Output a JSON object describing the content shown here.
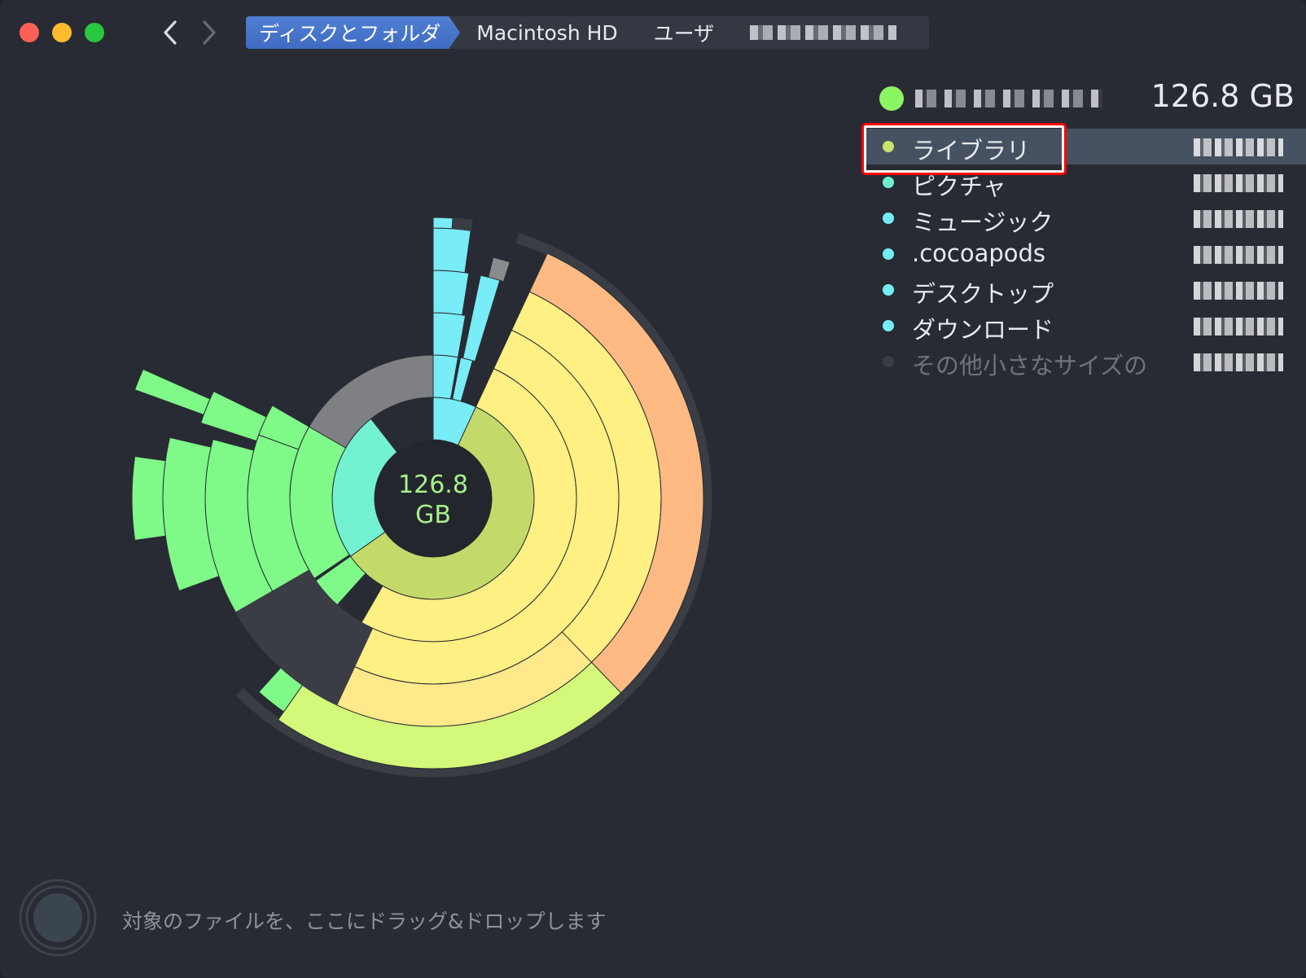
{
  "toolbar": {
    "breadcrumb": [
      {
        "label": "ディスクとフォルダ"
      },
      {
        "label": "Macintosh HD"
      },
      {
        "label": "ユーザ"
      }
    ]
  },
  "chart": {
    "center_label_line1": "126.8",
    "center_label_line2": "GB"
  },
  "panel": {
    "header_size": "126.8 GB",
    "items": [
      {
        "label": "ライブラリ",
        "color": "#c8e36e"
      },
      {
        "label": "ピクチャ",
        "color": "#70f0d2"
      },
      {
        "label": "ミュージック",
        "color": "#76ecf7"
      },
      {
        "label": ".cocoapods",
        "color": "#76ecf7"
      },
      {
        "label": "デスクトップ",
        "color": "#76ecf7"
      },
      {
        "label": "ダウンロード",
        "color": "#76ecf7"
      },
      {
        "label": "その他小さなサイズの項目",
        "color": "#3a3d44"
      }
    ]
  },
  "dropzone": {
    "text": "対象のファイルを、ここにドラッグ&ドロップします"
  }
}
